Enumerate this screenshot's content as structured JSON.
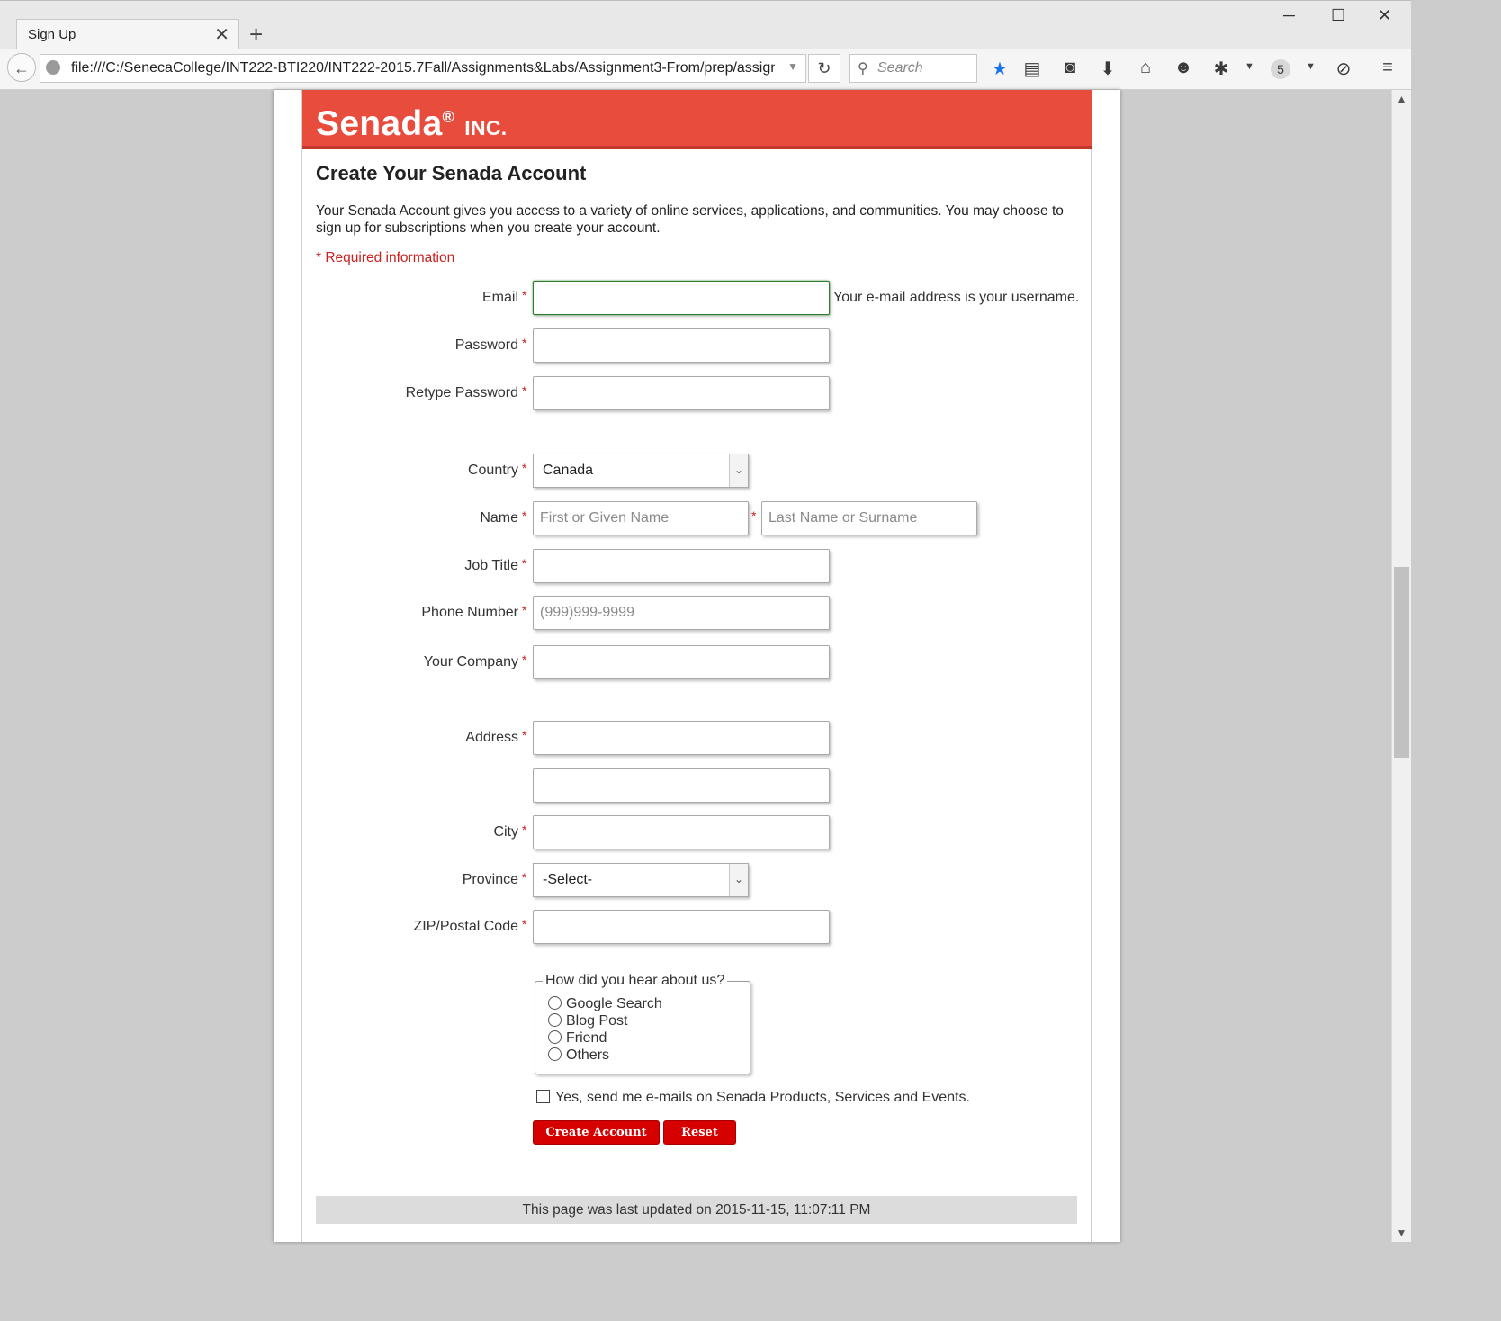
{
  "browser": {
    "tab_title": "Sign Up",
    "url": "file:///C:/SenecaCollege/INT222-BTI220/INT222-2015.7Fall/Assignments&Labs/Assignment3-From/prep/assign",
    "search_placeholder": "Search",
    "badge_count": "5"
  },
  "brand": {
    "name": "Senada",
    "reg": "®",
    "suffix": "INC."
  },
  "form": {
    "heading": "Create Your Senada Account",
    "intro": "Your Senada Account gives you access to a variety of online services, applications, and communities. You may choose to sign up for subscriptions when you create your account.",
    "required_note": "* Required information",
    "email_label": "Email",
    "email_hint": "Your e-mail address is your username.",
    "password_label": "Password",
    "retype_label": "Retype Password",
    "country_label": "Country",
    "country_value": "Canada",
    "name_label": "Name",
    "first_placeholder": "First or Given Name",
    "last_placeholder": "Last Name or Surname",
    "job_label": "Job Title",
    "phone_label": "Phone Number",
    "phone_placeholder": "(999)999-9999",
    "company_label": "Your Company",
    "address_label": "Address",
    "city_label": "City",
    "province_label": "Province",
    "province_value": "-Select-",
    "zip_label": "ZIP/Postal Code",
    "hear_legend": "How did you hear about us?",
    "hear_options": [
      "Google Search",
      "Blog Post",
      "Friend",
      "Others"
    ],
    "newsletter_label": "Yes, send me e-mails on Senada Products, Services and Events.",
    "create_button": "Create Account",
    "reset_button": "Reset",
    "asterisk": "*"
  },
  "footer": {
    "text": "This page was last updated on 2015-11-15, 11:07:11 PM"
  },
  "colors": {
    "banner": "#e84c3d",
    "button": "#d60000",
    "required": "#cc1f1f"
  }
}
